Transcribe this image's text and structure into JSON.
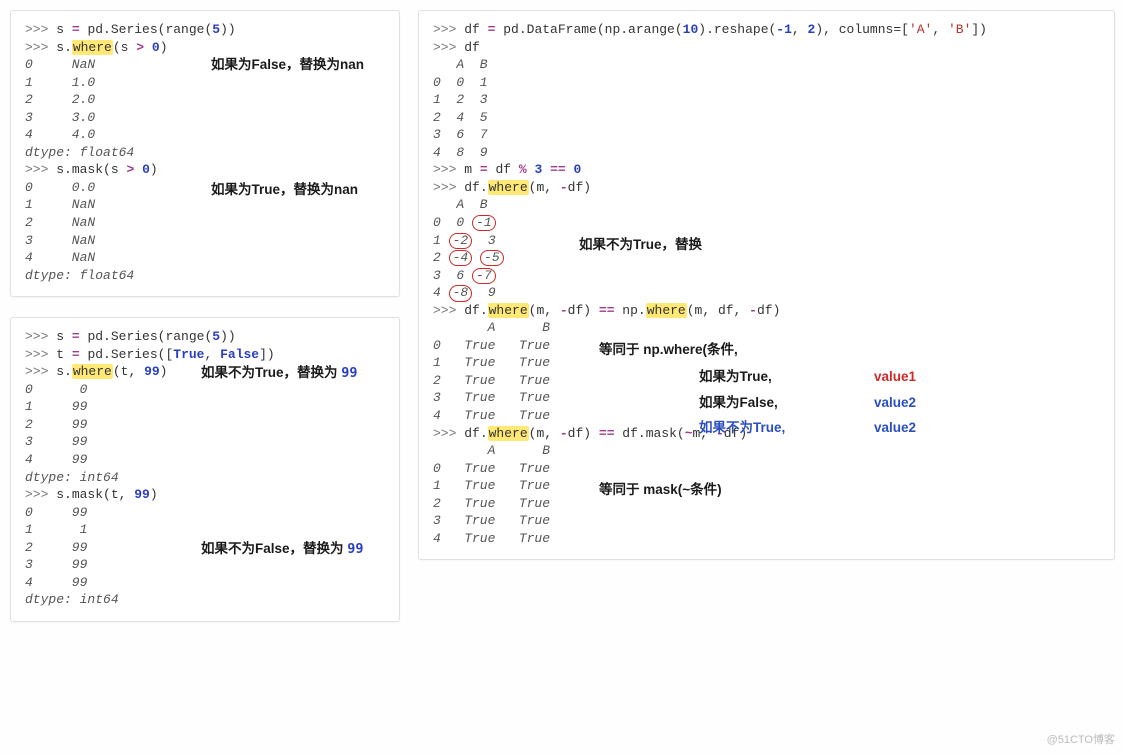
{
  "panel1": {
    "l01_pmt": ">>> ",
    "l01_a": "s ",
    "l01_eq": "= ",
    "l01_b": "pd.Series(range(",
    "l01_n5": "5",
    "l01_c": "))",
    "l02_pmt": ">>> ",
    "l02_a": "s.",
    "l02_where": "where",
    "l02_b": "(s ",
    "l02_gt": ">",
    "l02_sp": " ",
    "l02_n0": "0",
    "l02_c": ")",
    "o1_0": "0     NaN",
    "o1_1": "1     1.0",
    "o1_2": "2     2.0",
    "o1_3": "3     3.0",
    "o1_4": "4     4.0",
    "o1_dt": "dtype: float64",
    "l03_pmt": ">>> ",
    "l03_a": "s.mask(s ",
    "l03_gt": ">",
    "l03_sp": " ",
    "l03_n0": "0",
    "l03_b": ")",
    "o2_0": "0     0.0",
    "o2_1": "1     NaN",
    "o2_2": "2     NaN",
    "o2_3": "3     NaN",
    "o2_4": "4     NaN",
    "o2_dt": "dtype: float64",
    "ann1": "如果为False，替换为nan",
    "ann2": "如果为True，替换为nan"
  },
  "panel2": {
    "l01_pmt": ">>> ",
    "l01_a": "s ",
    "l01_eq": "= ",
    "l01_b": "pd.Series(range(",
    "l01_n5": "5",
    "l01_c": "))",
    "l02_pmt": ">>> ",
    "l02_a": "t ",
    "l02_eq": "= ",
    "l02_b": "pd.Series([",
    "l02_t": "True",
    "l02_com": ", ",
    "l02_f": "False",
    "l02_c": "])",
    "l03_pmt": ">>> ",
    "l03_a": "s.",
    "l03_where": "where",
    "l03_b": "(t, ",
    "l03_n99": "99",
    "l03_c": ")",
    "o1_0": "0      0",
    "o1_1": "1     99",
    "o1_2": "2     99",
    "o1_3": "3     99",
    "o1_4": "4     99",
    "o1_dt": "dtype: int64",
    "l04_pmt": ">>> ",
    "l04_a": "s.mask(t, ",
    "l04_n99": "99",
    "l04_b": ")",
    "o2_0": "0     99",
    "o2_1": "1      1",
    "o2_2": "2     99",
    "o2_3": "3     99",
    "o2_4": "4     99",
    "o2_dt": "dtype: int64",
    "ann1_a": "如果不为True，替换为 ",
    "ann1_b": "99",
    "ann2_a": "如果不为False，替换为 ",
    "ann2_b": "99"
  },
  "panel3": {
    "l01_pmt": ">>> ",
    "l01_a": "df ",
    "l01_eq": "= ",
    "l01_b": "pd.DataFrame(np.arange(",
    "l01_n10": "10",
    "l01_c": ").reshape(",
    "l01_nm1": "-1",
    "l01_com": ", ",
    "l01_n2": "2",
    "l01_d": "), columns=[",
    "l01_sA": "'A'",
    "l01_com2": ", ",
    "l01_sB": "'B'",
    "l01_e": "])",
    "l02_pmt": ">>> ",
    "l02_a": "df",
    "h1": "   A  B",
    "r0": "0  0  1",
    "r1": "1  2  3",
    "r2": "2  4  5",
    "r3": "3  6  7",
    "r4": "4  8  9",
    "l03_pmt": ">>> ",
    "l03_a": "m ",
    "l03_eq": "= ",
    "l03_b": "df ",
    "l03_pct": "%",
    "l03_sp": " ",
    "l03_n3": "3",
    "l03_sp2": " ",
    "l03_eqeq": "==",
    "l03_sp3": " ",
    "l03_n0": "0",
    "l04_pmt": ">>> ",
    "l04_a": "df.",
    "l04_where": "where",
    "l04_b": "(m, ",
    "l04_neg": "-",
    "l04_c": "df)",
    "h2": "   A  B",
    "w0_idx": "0",
    "w1_idx": "1",
    "w2_idx": "2",
    "w3_idx": "3",
    "w4_idx": "4",
    "cA0": " 0",
    "cB0": "-1",
    "cA1": "-2",
    "cB1": " 3",
    "cA2": "-4",
    "cB2": "-5",
    "cA3": " 6",
    "cB3": "-7",
    "cA4": "-8",
    "cB4": " 9",
    "l05_pmt": ">>> ",
    "l05_a": "df.",
    "l05_where1": "where",
    "l05_b": "(m, ",
    "l05_neg": "-",
    "l05_c": "df) ",
    "l05_eqeq": "==",
    "l05_d": " np.",
    "l05_where2": "where",
    "l05_e": "(m, df, ",
    "l05_neg2": "-",
    "l05_f": "df)",
    "h3": "       A      B",
    "t0": "0   True   True",
    "t1": "1   True   True",
    "t2": "2   True   True",
    "t3": "3   True   True",
    "t4": "4   True   True",
    "l06_pmt": ">>> ",
    "l06_a": "df.",
    "l06_where": "where",
    "l06_b": "(m, ",
    "l06_neg": "-",
    "l06_c": "df) ",
    "l06_eqeq": "==",
    "l06_d": " df.mask(",
    "l06_tilde": "~",
    "l06_e": "m, ",
    "l06_neg2": "-",
    "l06_f": "df)",
    "h4": "       A      B",
    "u0": "0   True   True",
    "u1": "1   True   True",
    "u2": "2   True   True",
    "u3": "3   True   True",
    "u4": "4   True   True",
    "ann_a": "如果不为True，替换",
    "ann_b": "等同于 np.where(条件,",
    "ann_c": "如果为True,",
    "ann_d": "如果为False,",
    "ann_e": "如果不为True,",
    "ann_v1": "value1",
    "ann_v2a": "value2",
    "ann_v2b": "value2",
    "ann_f": "等同于 mask(~条件)"
  },
  "watermark": "@51CTO博客"
}
